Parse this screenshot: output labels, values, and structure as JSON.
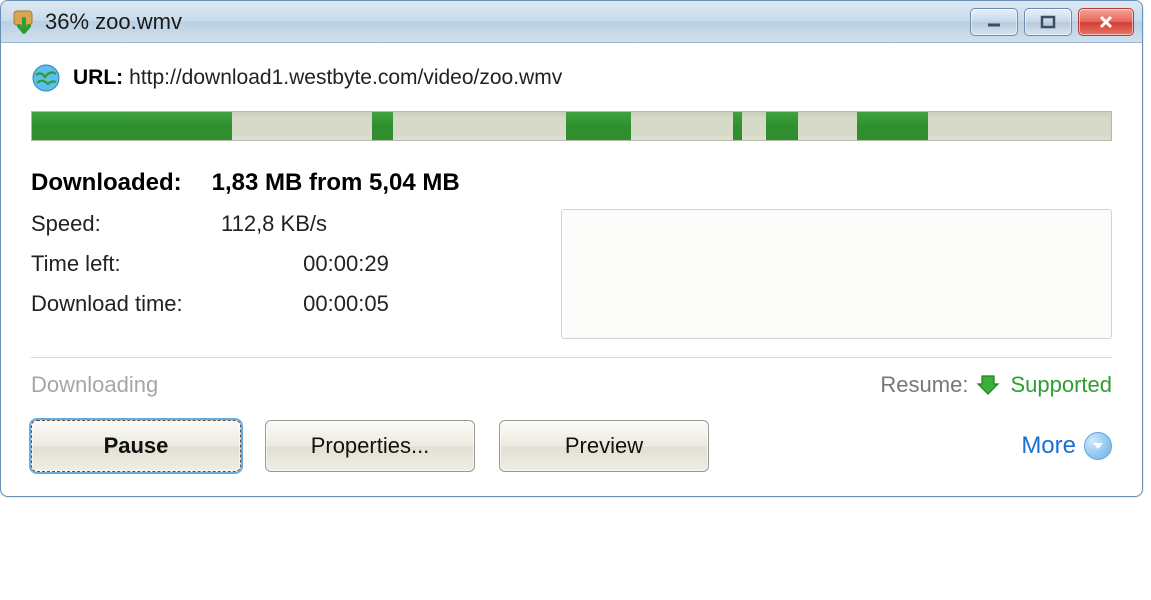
{
  "window": {
    "title": "36% zoo.wmv"
  },
  "url": {
    "label": "URL:",
    "value": "http://download1.westbyte.com/video/zoo.wmv"
  },
  "progress": {
    "segments": [
      {
        "fill": true,
        "pct": 18.5
      },
      {
        "fill": false,
        "pct": 13.0
      },
      {
        "fill": true,
        "pct": 2.0
      },
      {
        "fill": false,
        "pct": 16.0
      },
      {
        "fill": true,
        "pct": 6.0
      },
      {
        "fill": false,
        "pct": 9.5
      },
      {
        "fill": true,
        "pct": 0.8
      },
      {
        "fill": false,
        "pct": 2.2
      },
      {
        "fill": true,
        "pct": 3.0
      },
      {
        "fill": false,
        "pct": 5.5
      },
      {
        "fill": true,
        "pct": 6.5
      },
      {
        "fill": false,
        "pct": 17.0
      }
    ]
  },
  "downloaded": {
    "label": "Downloaded:",
    "value": "1,83 MB from 5,04 MB"
  },
  "stats": {
    "speed": {
      "label": "Speed:",
      "value": "112,8 KB/s"
    },
    "timeleft": {
      "label": "Time left:",
      "value": "00:00:29"
    },
    "dltime": {
      "label": "Download time:",
      "value": "00:00:05"
    }
  },
  "status": {
    "text": "Downloading",
    "resume_label": "Resume:",
    "resume_value": "Supported"
  },
  "buttons": {
    "pause": "Pause",
    "properties": "Properties...",
    "preview": "Preview",
    "more": "More"
  }
}
